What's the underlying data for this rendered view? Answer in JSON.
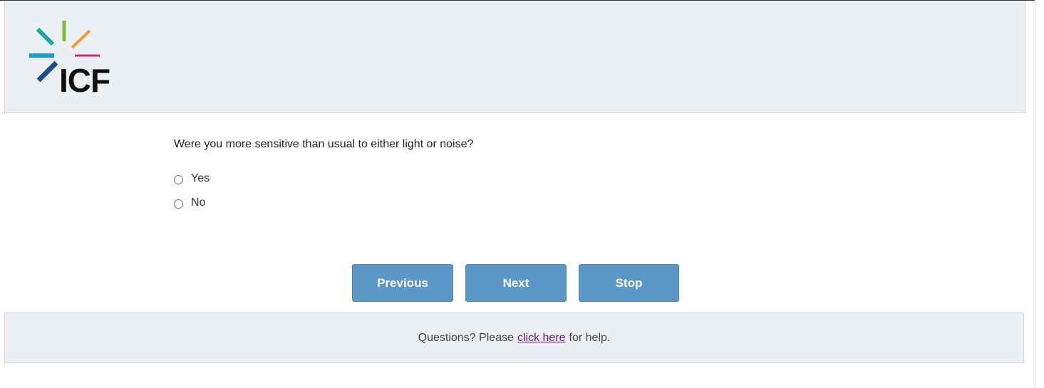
{
  "brand": {
    "name": "ICF",
    "colors": {
      "teal": "#1ea7a3",
      "green": "#7bbf3a",
      "orange": "#f29d38",
      "blue": "#1b9ad6",
      "magenta": "#d6246f",
      "navy": "#1a4f8c",
      "text": "#111111"
    }
  },
  "question": {
    "text": "Were you more sensitive than usual to either light or noise?",
    "options": [
      {
        "label": "Yes",
        "selected": false
      },
      {
        "label": "No",
        "selected": false
      }
    ]
  },
  "navigation": {
    "previous_label": "Previous",
    "next_label": "Next",
    "stop_label": "Stop",
    "button_color": "#5b97c7"
  },
  "footer": {
    "prefix": "Questions? Please",
    "link_text": "click here",
    "suffix": "for help."
  }
}
